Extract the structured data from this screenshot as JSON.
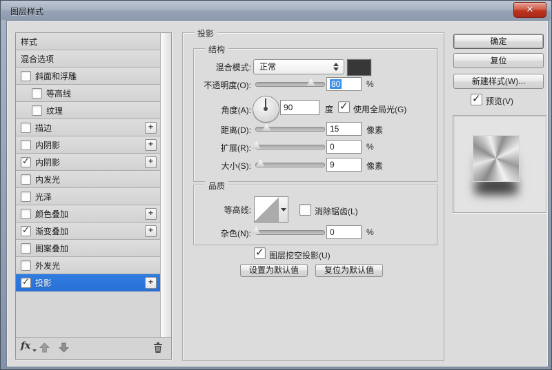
{
  "window": {
    "title": "图层样式",
    "close_glyph": "✕"
  },
  "colors": {
    "selection": "#2f7de0",
    "value_selection": "#3d8fe8",
    "shadow_swatch": "#373737"
  },
  "sidebar": {
    "items": [
      {
        "key": "styles",
        "label": "样式",
        "checkbox": null,
        "plus": false,
        "indent": false,
        "selected": false
      },
      {
        "key": "blending-options",
        "label": "混合选项",
        "checkbox": null,
        "plus": false,
        "indent": false,
        "selected": false
      },
      {
        "key": "bevel-emboss",
        "label": "斜面和浮雕",
        "checkbox": false,
        "plus": false,
        "indent": false,
        "selected": false
      },
      {
        "key": "contour",
        "label": "等高线",
        "checkbox": false,
        "plus": false,
        "indent": true,
        "selected": false
      },
      {
        "key": "texture",
        "label": "纹理",
        "checkbox": false,
        "plus": false,
        "indent": true,
        "selected": false
      },
      {
        "key": "stroke",
        "label": "描边",
        "checkbox": false,
        "plus": true,
        "indent": false,
        "selected": false
      },
      {
        "key": "inner-shadow",
        "label": "内阴影",
        "checkbox": false,
        "plus": true,
        "indent": false,
        "selected": false
      },
      {
        "key": "inner-shadow-2",
        "label": "内阴影",
        "checkbox": true,
        "plus": true,
        "indent": false,
        "selected": false
      },
      {
        "key": "inner-glow",
        "label": "内发光",
        "checkbox": false,
        "plus": false,
        "indent": false,
        "selected": false
      },
      {
        "key": "satin",
        "label": "光泽",
        "checkbox": false,
        "plus": false,
        "indent": false,
        "selected": false
      },
      {
        "key": "color-overlay",
        "label": "颜色叠加",
        "checkbox": false,
        "plus": true,
        "indent": false,
        "selected": false
      },
      {
        "key": "gradient-overlay",
        "label": "渐变叠加",
        "checkbox": true,
        "plus": true,
        "indent": false,
        "selected": false
      },
      {
        "key": "pattern-overlay",
        "label": "图案叠加",
        "checkbox": false,
        "plus": false,
        "indent": false,
        "selected": false
      },
      {
        "key": "outer-glow",
        "label": "外发光",
        "checkbox": false,
        "plus": false,
        "indent": false,
        "selected": false
      },
      {
        "key": "drop-shadow",
        "label": "投影",
        "checkbox": true,
        "plus": true,
        "indent": false,
        "selected": true
      }
    ],
    "toolbar": {
      "fx_label": "fx"
    }
  },
  "main": {
    "title": "投影",
    "structure": {
      "legend": "结构",
      "blend_mode_label": "混合模式:",
      "blend_mode_value": "正常",
      "opacity_label": "不透明度(O):",
      "opacity_value": "80",
      "opacity_unit": "%",
      "angle_label": "角度(A):",
      "angle_value": "90",
      "angle_unit": "度",
      "global_light_label": "使用全局光(G)",
      "global_light_checked": true,
      "distance_label": "距离(D):",
      "distance_value": "15",
      "distance_unit": "像素",
      "spread_label": "扩展(R):",
      "spread_value": "0",
      "spread_unit": "%",
      "size_label": "大小(S):",
      "size_value": "9",
      "size_unit": "像素"
    },
    "quality": {
      "legend": "品质",
      "contour_label": "等高线:",
      "antialias_label": "消除锯齿(L)",
      "antialias_checked": false,
      "noise_label": "杂色(N):",
      "noise_value": "0",
      "noise_unit": "%"
    },
    "knockout_label": "图层挖空投影(U)",
    "knockout_checked": true,
    "make_default_label": "设置为默认值",
    "reset_default_label": "复位为默认值"
  },
  "actions": {
    "ok_label": "确定",
    "reset_label": "复位",
    "new_style_label": "新建样式(W)...",
    "preview_label": "预览(V)",
    "preview_checked": true
  },
  "sliders": {
    "opacity_pct": 80,
    "distance_pct": 15,
    "spread_pct": 0,
    "size_pct": 6,
    "noise_pct": 0
  }
}
